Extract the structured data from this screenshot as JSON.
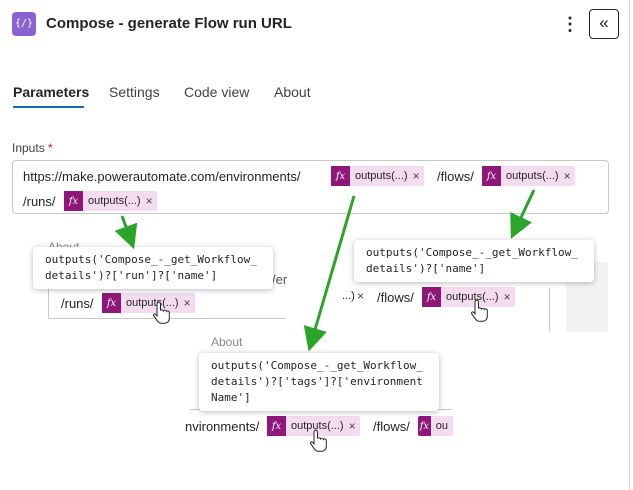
{
  "header": {
    "app_icon_glyph": "{/}",
    "title": "Compose - generate Flow run URL",
    "more_glyph": "⋮",
    "collapse_glyph": "«"
  },
  "tabs": [
    {
      "label": "Parameters",
      "active": true
    },
    {
      "label": "Settings",
      "active": false
    },
    {
      "label": "Code view",
      "active": false
    },
    {
      "label": "About",
      "active": false
    }
  ],
  "inputs": {
    "label": "Inputs",
    "required_mark": "*",
    "segments": {
      "url_prefix": "https://make.powerautomate.com/environments/",
      "flows": "/flows/",
      "runs": "/runs/"
    },
    "token_label": "outputs(...)",
    "fx_glyph": "fx",
    "remove_glyph": "×"
  },
  "zooms": {
    "left_tooltip": "outputs('Compose_-_get_Workflow_\ndetails')?['run']?['name']",
    "left_behind_text": "/runs/",
    "left_partial_tab": "About",
    "left_partial_frag": "/er",
    "right_tooltip": "outputs('Compose_-_get_Workflow_\ndetails')?['name']",
    "right_ellipsis_frag": "...)",
    "right_flows": "/flows/",
    "center_tooltip": "outputs('Compose_-_get_Workflow_\ndetails')?['tags']?['environment\nName']",
    "center_behind_tab": "About",
    "center_env_text": "nvironments/",
    "center_flows": "/flows/",
    "center_cut_token": "ou"
  },
  "colors": {
    "accent": "#0f6cbd",
    "fx_badge": "#8f1779",
    "token_bg": "#f4dcf0",
    "arrow": "#2aa52a"
  }
}
